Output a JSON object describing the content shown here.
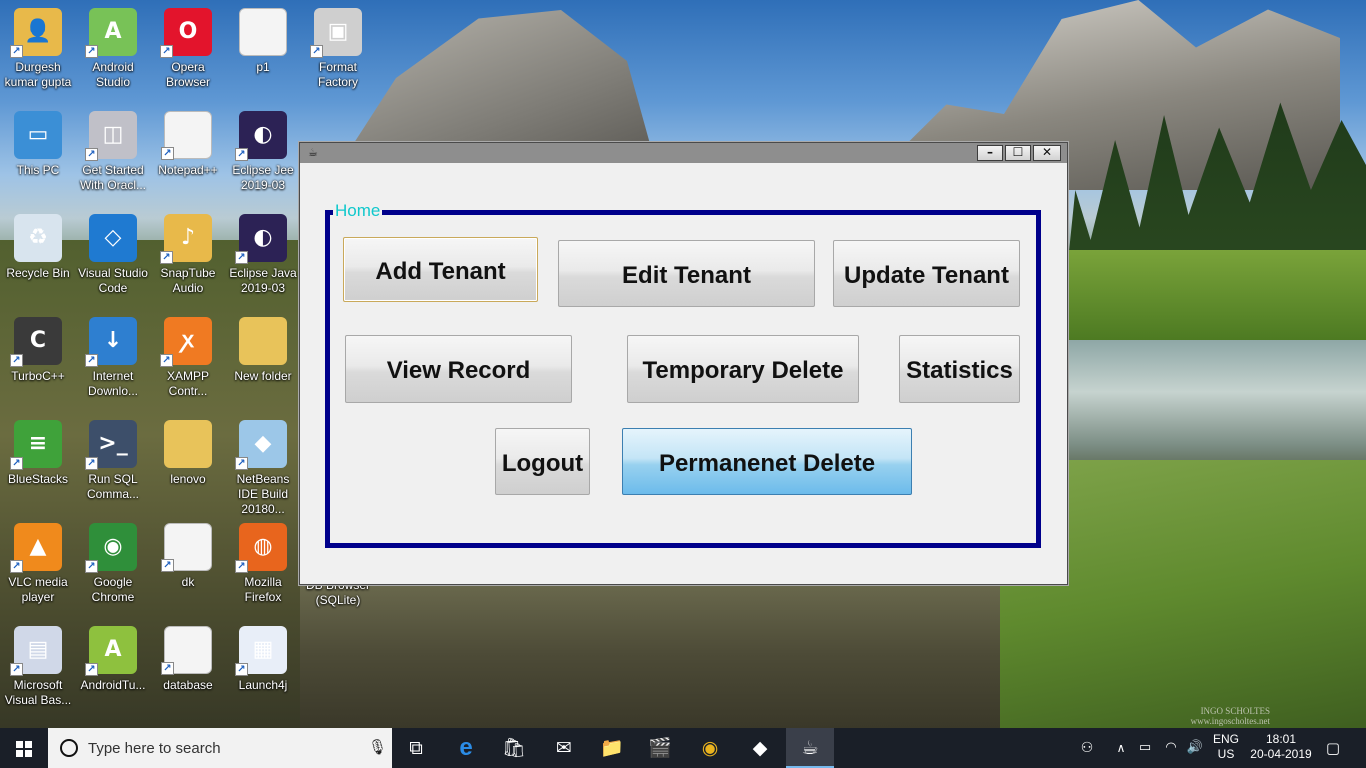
{
  "desktop": {
    "icons": [
      {
        "label": "Durgesh kumar gupta",
        "icon": "user-folder-icon",
        "color": "#e8b94a"
      },
      {
        "label": "Android Studio",
        "icon": "android-studio-icon",
        "color": "#78c257"
      },
      {
        "label": "Opera Browser",
        "icon": "opera-icon",
        "color": "#e3142c"
      },
      {
        "label": "p1",
        "icon": "document-icon",
        "color": "#f4f4f4"
      },
      {
        "label": "Format Factory",
        "icon": "format-factory-icon",
        "color": "#cfcfcf"
      },
      {
        "label": "This PC",
        "icon": "computer-icon",
        "color": "#3b8fd6"
      },
      {
        "label": "Get Started With Oracl...",
        "icon": "oracle-db-icon",
        "color": "#c0c0c8"
      },
      {
        "label": "Notepad++",
        "icon": "document-icon",
        "color": "#f4f4f4"
      },
      {
        "label": "Eclipse Jee 2019-03",
        "icon": "eclipse-icon",
        "color": "#2c2255"
      },
      {
        "label": "Recycle Bin",
        "icon": "recycle-bin-icon",
        "color": "#d8e4ee"
      },
      {
        "label": "Visual Studio Code",
        "icon": "vscode-icon",
        "color": "#1f7ad1"
      },
      {
        "label": "SnapTube Audio",
        "icon": "snaptube-folder-icon",
        "color": "#e8b94a"
      },
      {
        "label": "Eclipse Java 2019-03",
        "icon": "eclipse-icon",
        "color": "#2c2255"
      },
      {
        "label": "TurboC++",
        "icon": "turboc-icon",
        "color": "#3a3a3a"
      },
      {
        "label": "Internet Downlo...",
        "icon": "idm-icon",
        "color": "#2e7fd0"
      },
      {
        "label": "XAMPP Contr...",
        "icon": "xampp-icon",
        "color": "#f07a22"
      },
      {
        "label": "New folder",
        "icon": "folder-icon",
        "color": "#e8c35a"
      },
      {
        "label": "BlueStacks",
        "icon": "bluestacks-icon",
        "color": "#3fa23a"
      },
      {
        "label": "Run SQL Comma...",
        "icon": "sql-icon",
        "color": "#3d4f6a"
      },
      {
        "label": "lenovo",
        "icon": "folder-icon",
        "color": "#e8c35a"
      },
      {
        "label": "NetBeans IDE Build 20180...",
        "icon": "netbeans-icon",
        "color": "#9cc7e8"
      },
      {
        "label": "VLC media player",
        "icon": "vlc-icon",
        "color": "#f08a1c"
      },
      {
        "label": "Google Chrome",
        "icon": "chrome-icon",
        "color": "#2f8f3a"
      },
      {
        "label": "dk",
        "icon": "document-icon",
        "color": "#f4f4f4"
      },
      {
        "label": "Mozilla Firefox",
        "icon": "firefox-icon",
        "color": "#e8651d"
      },
      {
        "label": "Microsoft Visual Bas...",
        "icon": "visual-basic-icon",
        "color": "#d0d8e8"
      },
      {
        "label": "AndroidTu...",
        "icon": "android-tool-icon",
        "color": "#8ec13e"
      },
      {
        "label": "database",
        "icon": "document-icon",
        "color": "#f4f4f4"
      },
      {
        "label": "Launch4j",
        "icon": "launch4j-icon",
        "color": "#e8eef8"
      }
    ],
    "partial_labels": {
      "db_browser": "DB Browser (SQLite)"
    },
    "watermark_line1": "INGO SCHOLTES",
    "watermark_line2": "www.ingoscholtes.net"
  },
  "window": {
    "app_icon": "java-cup-icon",
    "controls": {
      "minimize": "–",
      "maximize": "☐",
      "close": "✕"
    },
    "group_title": "Home",
    "buttons": {
      "add_tenant": "Add Tenant",
      "edit_tenant": "Edit Tenant",
      "update_tenant": "Update Tenant",
      "view_record": "View Record",
      "temporary_delete": "Temporary Delete",
      "statistics": "Statistics",
      "logout": "Logout",
      "permanent_delete": "Permanenet Delete"
    },
    "colors": {
      "group_border": "#00008b",
      "group_title": "#10c8cc",
      "active_button": "#98d1ef"
    }
  },
  "taskbar": {
    "search_placeholder": "Type here to search",
    "apps": [
      {
        "name": "task-view-icon",
        "glyph": "⧉"
      },
      {
        "name": "edge-icon",
        "glyph": "e"
      },
      {
        "name": "store-icon",
        "glyph": "🛍"
      },
      {
        "name": "mail-icon",
        "glyph": "✉"
      },
      {
        "name": "file-explorer-icon",
        "glyph": "📁"
      },
      {
        "name": "movies-icon",
        "glyph": "🎬"
      },
      {
        "name": "chrome-icon",
        "glyph": "◉"
      },
      {
        "name": "netbeans-icon",
        "glyph": "◆"
      },
      {
        "name": "java-icon",
        "glyph": "☕"
      }
    ],
    "lang_top": "ENG",
    "lang_bottom": "US",
    "time": "18:01",
    "date": "20-04-2019"
  }
}
